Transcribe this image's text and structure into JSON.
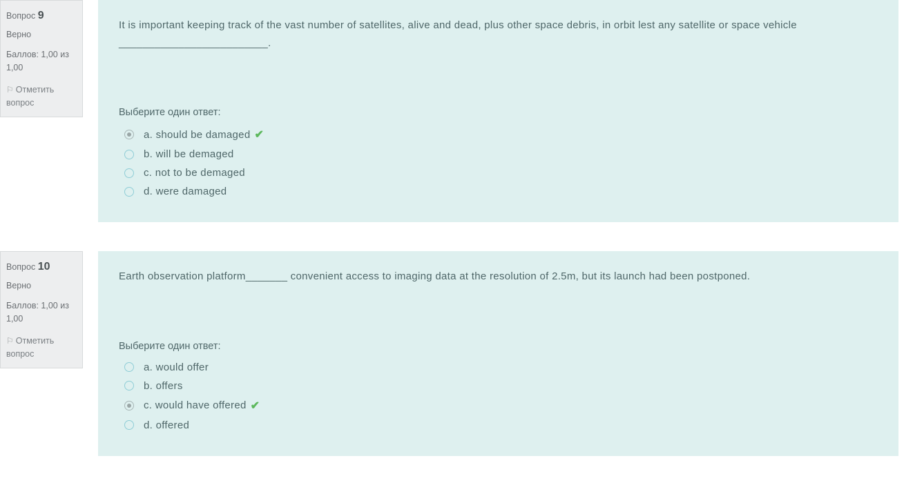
{
  "labels": {
    "question_prefix": "Вопрос",
    "choose_prompt": "Выберите один ответ:",
    "flag_text": "Отметить вопрос"
  },
  "questions": [
    {
      "number": "9",
      "status": "Верно",
      "score": "Баллов: 1,00 из 1,00",
      "text": "It is important keeping track of the vast number of satellites, alive and dead, plus other space debris, in orbit lest any satellite or space vehicle _________________________.",
      "answers": [
        {
          "letter": "a.",
          "text": "should be damaged",
          "selected": true,
          "correct": true
        },
        {
          "letter": "b.",
          "text": "will be demaged",
          "selected": false,
          "correct": false
        },
        {
          "letter": "c.",
          "text": "not to be demaged",
          "selected": false,
          "correct": false
        },
        {
          "letter": "d.",
          "text": "were damaged",
          "selected": false,
          "correct": false
        }
      ]
    },
    {
      "number": "10",
      "status": "Верно",
      "score": "Баллов: 1,00 из 1,00",
      "text": "Earth observation platform_______ convenient access to imaging data at the resolution of 2.5m, but its launch had been postponed.",
      "answers": [
        {
          "letter": "a.",
          "text": "would offer",
          "selected": false,
          "correct": false
        },
        {
          "letter": "b.",
          "text": "offers",
          "selected": false,
          "correct": false
        },
        {
          "letter": "c.",
          "text": "would have offered",
          "selected": true,
          "correct": true
        },
        {
          "letter": "d.",
          "text": "offered",
          "selected": false,
          "correct": false
        }
      ]
    }
  ]
}
